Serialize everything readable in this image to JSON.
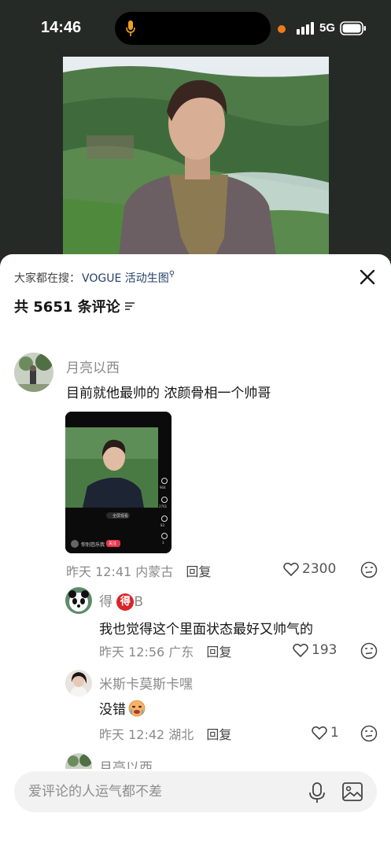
{
  "status_bar": {
    "time": "14:46",
    "network": "5G",
    "icons": [
      "microphone-indicator-icon",
      "recording-dot-icon",
      "signal-icon",
      "battery-icon"
    ],
    "accent_orange": "#f07a1a"
  },
  "comments_panel": {
    "search_prefix": "大家都在搜：",
    "search_term": "VOGUE 活动生图",
    "comment_count": "共 5651 条评论",
    "close_icon": "close-icon",
    "sort_icon": "sort-icon"
  },
  "comments": [
    {
      "user": "月亮以西",
      "text": "目前就他最帅的 浓颜骨相一个帅哥",
      "time": "昨天 12:41",
      "location": "内蒙古",
      "reply_label": "回复",
      "likes": "2300",
      "thumbnail": {
        "author": "你别芭乐我",
        "follow_label": "关注",
        "fullscreen_label": "全屏观看",
        "side_counts": [
          "904",
          "2761",
          "83",
          "3"
        ]
      }
    },
    {
      "user_prefix": "得",
      "user_badge": "得",
      "user_suffix": "B",
      "text": "我也觉得这个里面状态最好又帅气的",
      "time": "昨天 12:56",
      "location": "广东",
      "reply_label": "回复",
      "likes": "193"
    },
    {
      "user": "米斯卡莫斯卡嘿",
      "text": "没错",
      "time": "昨天 12:42",
      "location": "湖北",
      "reply_label": "回复",
      "likes": "1"
    },
    {
      "user": "月亮以西"
    }
  ],
  "input": {
    "placeholder": "爱评论的人运气都不差",
    "icons": [
      "microphone-icon",
      "image-icon"
    ]
  }
}
